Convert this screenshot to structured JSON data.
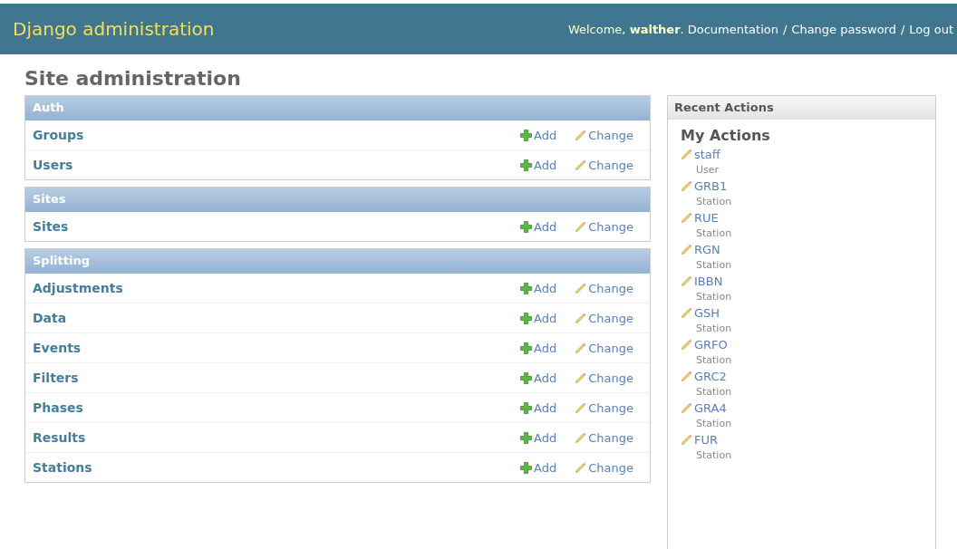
{
  "header": {
    "title": "Django administration",
    "welcome": "Welcome, **walther**.",
    "links": [
      {
        "kind": "link",
        "label": "Documentation"
      },
      {
        "kind": "sep",
        "label": "/"
      },
      {
        "kind": "link",
        "label": "Change password"
      },
      {
        "kind": "sep",
        "label": "/"
      },
      {
        "kind": "link",
        "label": "Log out"
      }
    ]
  },
  "page_title": "Site administration",
  "modules": [
    {
      "caption": "Auth",
      "models": [
        {
          "name": "Groups",
          "add": "Add",
          "change": "Change"
        },
        {
          "name": "Users",
          "add": "Add",
          "change": "Change"
        }
      ]
    },
    {
      "caption": "Sites",
      "models": [
        {
          "name": "Sites",
          "add": "Add",
          "change": "Change"
        }
      ]
    },
    {
      "caption": "Splitting",
      "models": [
        {
          "name": "Adjustments",
          "add": "Add",
          "change": "Change"
        },
        {
          "name": "Data",
          "add": "Add",
          "change": "Change"
        },
        {
          "name": "Events",
          "add": "Add",
          "change": "Change"
        },
        {
          "name": "Filters",
          "add": "Add",
          "change": "Change"
        },
        {
          "name": "Phases",
          "add": "Add",
          "change": "Change"
        },
        {
          "name": "Results",
          "add": "Add",
          "change": "Change"
        },
        {
          "name": "Stations",
          "add": "Add",
          "change": "Change"
        }
      ]
    }
  ],
  "recent": {
    "caption": "Recent Actions",
    "heading": "My Actions",
    "actions": [
      {
        "name": "staff",
        "type": "User"
      },
      {
        "name": "GRB1",
        "type": "Station"
      },
      {
        "name": "RUE",
        "type": "Station"
      },
      {
        "name": "RGN",
        "type": "Station"
      },
      {
        "name": "IBBN",
        "type": "Station"
      },
      {
        "name": "GSH",
        "type": "Station"
      },
      {
        "name": "GRFO",
        "type": "Station"
      },
      {
        "name": "GRC2",
        "type": "Station"
      },
      {
        "name": "GRA4",
        "type": "Station"
      },
      {
        "name": "FUR",
        "type": "Station"
      }
    ]
  }
}
